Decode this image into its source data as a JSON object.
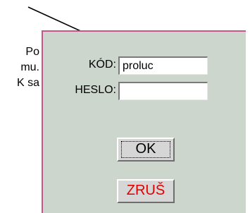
{
  "background_text": {
    "line1": "Po",
    "line2": "mu.",
    "line3": "K sa"
  },
  "login": {
    "code_label": "KÓD:",
    "code_value": "proluc",
    "password_label": "HESLO:",
    "password_value": "",
    "ok_label": "OK",
    "cancel_label": "ZRUŠ"
  },
  "colors": {
    "panel_bg": "#cdd6cd",
    "panel_border": "#c7558b",
    "cancel_text": "#e00000"
  }
}
